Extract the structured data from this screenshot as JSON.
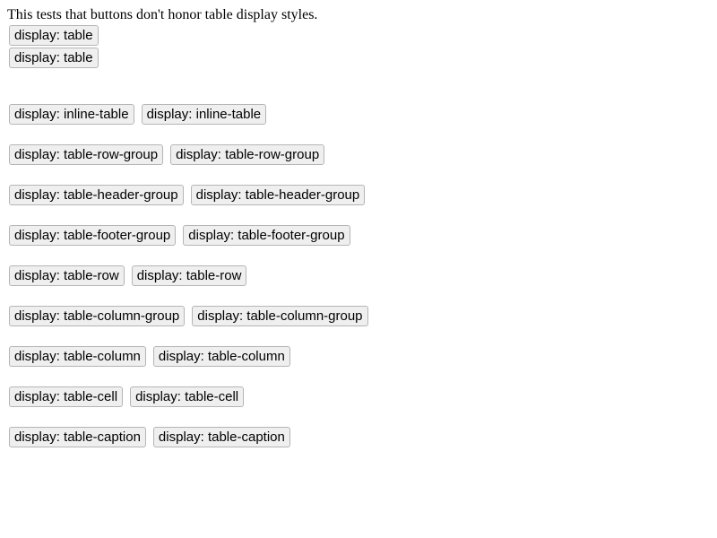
{
  "intro_text": "This tests that buttons don't honor table display styles.",
  "rows": [
    [
      "display: table"
    ],
    [
      "display: table"
    ],
    [
      "display: inline-table",
      "display: inline-table"
    ],
    [
      "display: table-row-group",
      "display: table-row-group"
    ],
    [
      "display: table-header-group",
      "display: table-header-group"
    ],
    [
      "display: table-footer-group",
      "display: table-footer-group"
    ],
    [
      "display: table-row",
      "display: table-row"
    ],
    [
      "display: table-column-group",
      "display: table-column-group"
    ],
    [
      "display: table-column",
      "display: table-column"
    ],
    [
      "display: table-cell",
      "display: table-cell"
    ],
    [
      "display: table-caption",
      "display: table-caption"
    ]
  ],
  "colors": {
    "button_bg": "#efefef",
    "button_border": "#b5b5b5",
    "text": "#000000"
  }
}
